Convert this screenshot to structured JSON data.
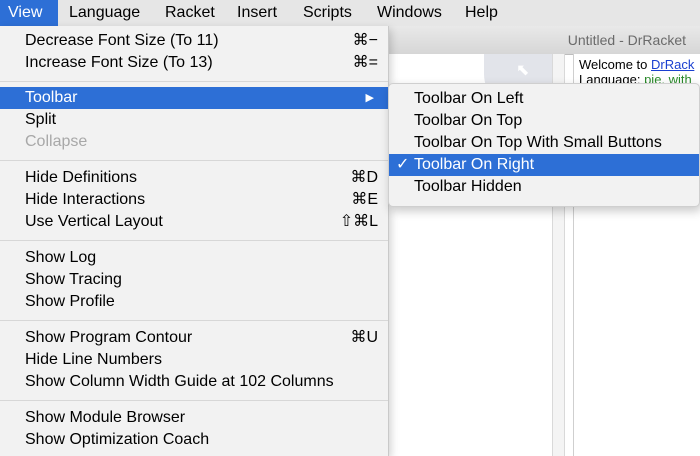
{
  "menubar": {
    "items": [
      "View",
      "Language",
      "Racket",
      "Insert",
      "Scripts",
      "Windows",
      "Help"
    ]
  },
  "window": {
    "title": "Untitled - DrRacket",
    "welcome_prefix": "Welcome to ",
    "welcome_link": "DrRack",
    "language_prefix": "Language: ",
    "language_value": "pie, with"
  },
  "view_menu": {
    "decrease_font": {
      "label": "Decrease Font Size (To 11)",
      "shortcut": "⌘−"
    },
    "increase_font": {
      "label": "Increase Font Size (To 13)",
      "shortcut": "⌘="
    },
    "toolbar": {
      "label": "Toolbar",
      "arrow": "▶"
    },
    "split": {
      "label": "Split"
    },
    "collapse": {
      "label": "Collapse"
    },
    "hide_definitions": {
      "label": "Hide Definitions",
      "shortcut": "⌘D"
    },
    "hide_interactions": {
      "label": "Hide Interactions",
      "shortcut": "⌘E"
    },
    "vertical_layout": {
      "label": "Use Vertical Layout",
      "shortcut": "⇧⌘L"
    },
    "show_log": {
      "label": "Show Log"
    },
    "show_tracing": {
      "label": "Show Tracing"
    },
    "show_profile": {
      "label": "Show Profile"
    },
    "program_contour": {
      "label": "Show Program Contour",
      "shortcut": "⌘U"
    },
    "line_numbers": {
      "label": "Hide Line Numbers"
    },
    "column_guide": {
      "label": "Show Column Width Guide at 102 Columns"
    },
    "module_browser": {
      "label": "Show Module Browser"
    },
    "optimization_coach": {
      "label": "Show Optimization Coach"
    }
  },
  "toolbar_submenu": {
    "checkmark": "✓",
    "items": [
      "Toolbar On Left",
      "Toolbar On Top",
      "Toolbar On Top With Small Buttons",
      "Toolbar On Right",
      "Toolbar Hidden"
    ],
    "selected": "Toolbar On Right"
  },
  "colors": {
    "highlight": "#2d6fd6"
  }
}
